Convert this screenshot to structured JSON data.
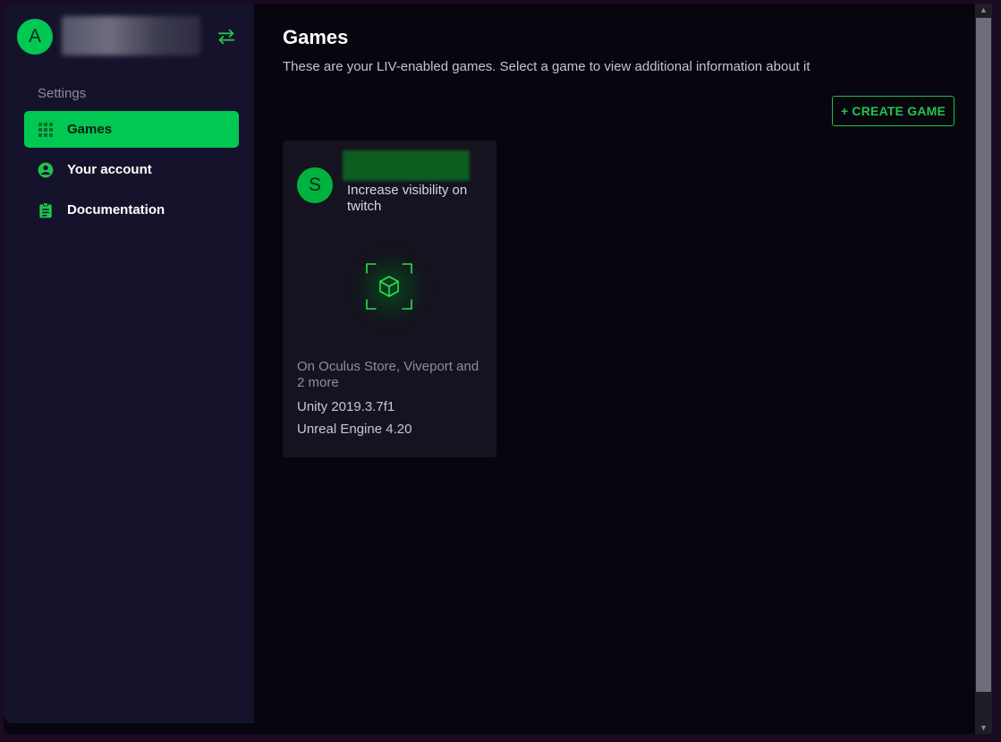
{
  "user": {
    "avatar_letter": "A"
  },
  "sidebar": {
    "section_label": "Settings",
    "items": [
      {
        "label": "Games",
        "icon": "grid-icon",
        "active": true
      },
      {
        "label": "Your account",
        "icon": "account-circle-icon",
        "active": false
      },
      {
        "label": "Documentation",
        "icon": "clipboard-icon",
        "active": false
      }
    ]
  },
  "main": {
    "title": "Games",
    "subtitle": "These are your LIV-enabled games. Select a game to view additional information about it",
    "create_button_label": "+ CREATE GAME"
  },
  "games": [
    {
      "avatar_letter": "S",
      "description": "Increase visibility on twitch",
      "stores": "On Oculus Store, Viveport and 2 more",
      "engines": [
        "Unity 2019.3.7f1",
        "Unreal Engine 4.20"
      ]
    }
  ],
  "colors": {
    "accent": "#00c853",
    "sidebar_bg": "#15132b",
    "main_bg": "#07050d",
    "card_bg": "#15131f"
  }
}
